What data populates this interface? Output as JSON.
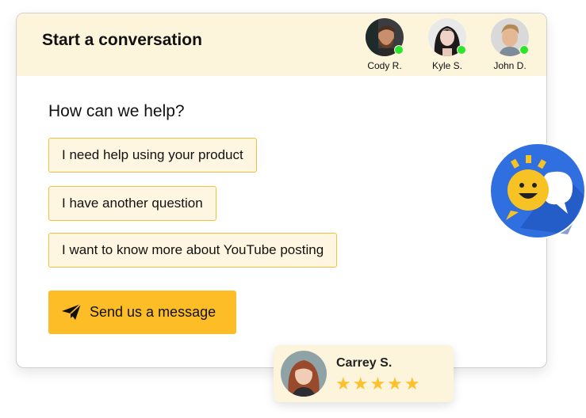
{
  "header": {
    "title": "Start a conversation"
  },
  "agents": [
    {
      "name": "Cody R.",
      "status": "online"
    },
    {
      "name": "Kyle S.",
      "status": "online"
    },
    {
      "name": "John D.",
      "status": "online"
    }
  ],
  "main": {
    "question": "How can we help?",
    "options": [
      "I need help using your product",
      "I have another question",
      "I want to know more about YouTube posting"
    ],
    "send_button": {
      "label": "Send us a message",
      "icon": "paper-plane-icon"
    }
  },
  "review": {
    "name": "Carrey S.",
    "rating": 5,
    "stars": "★★★★★"
  },
  "colors": {
    "accent": "#fcbd27",
    "header_bg": "#fdf4dc",
    "option_border": "#f2c13a",
    "online": "#2ee52e",
    "badge_blue": "#1f5fd6"
  }
}
